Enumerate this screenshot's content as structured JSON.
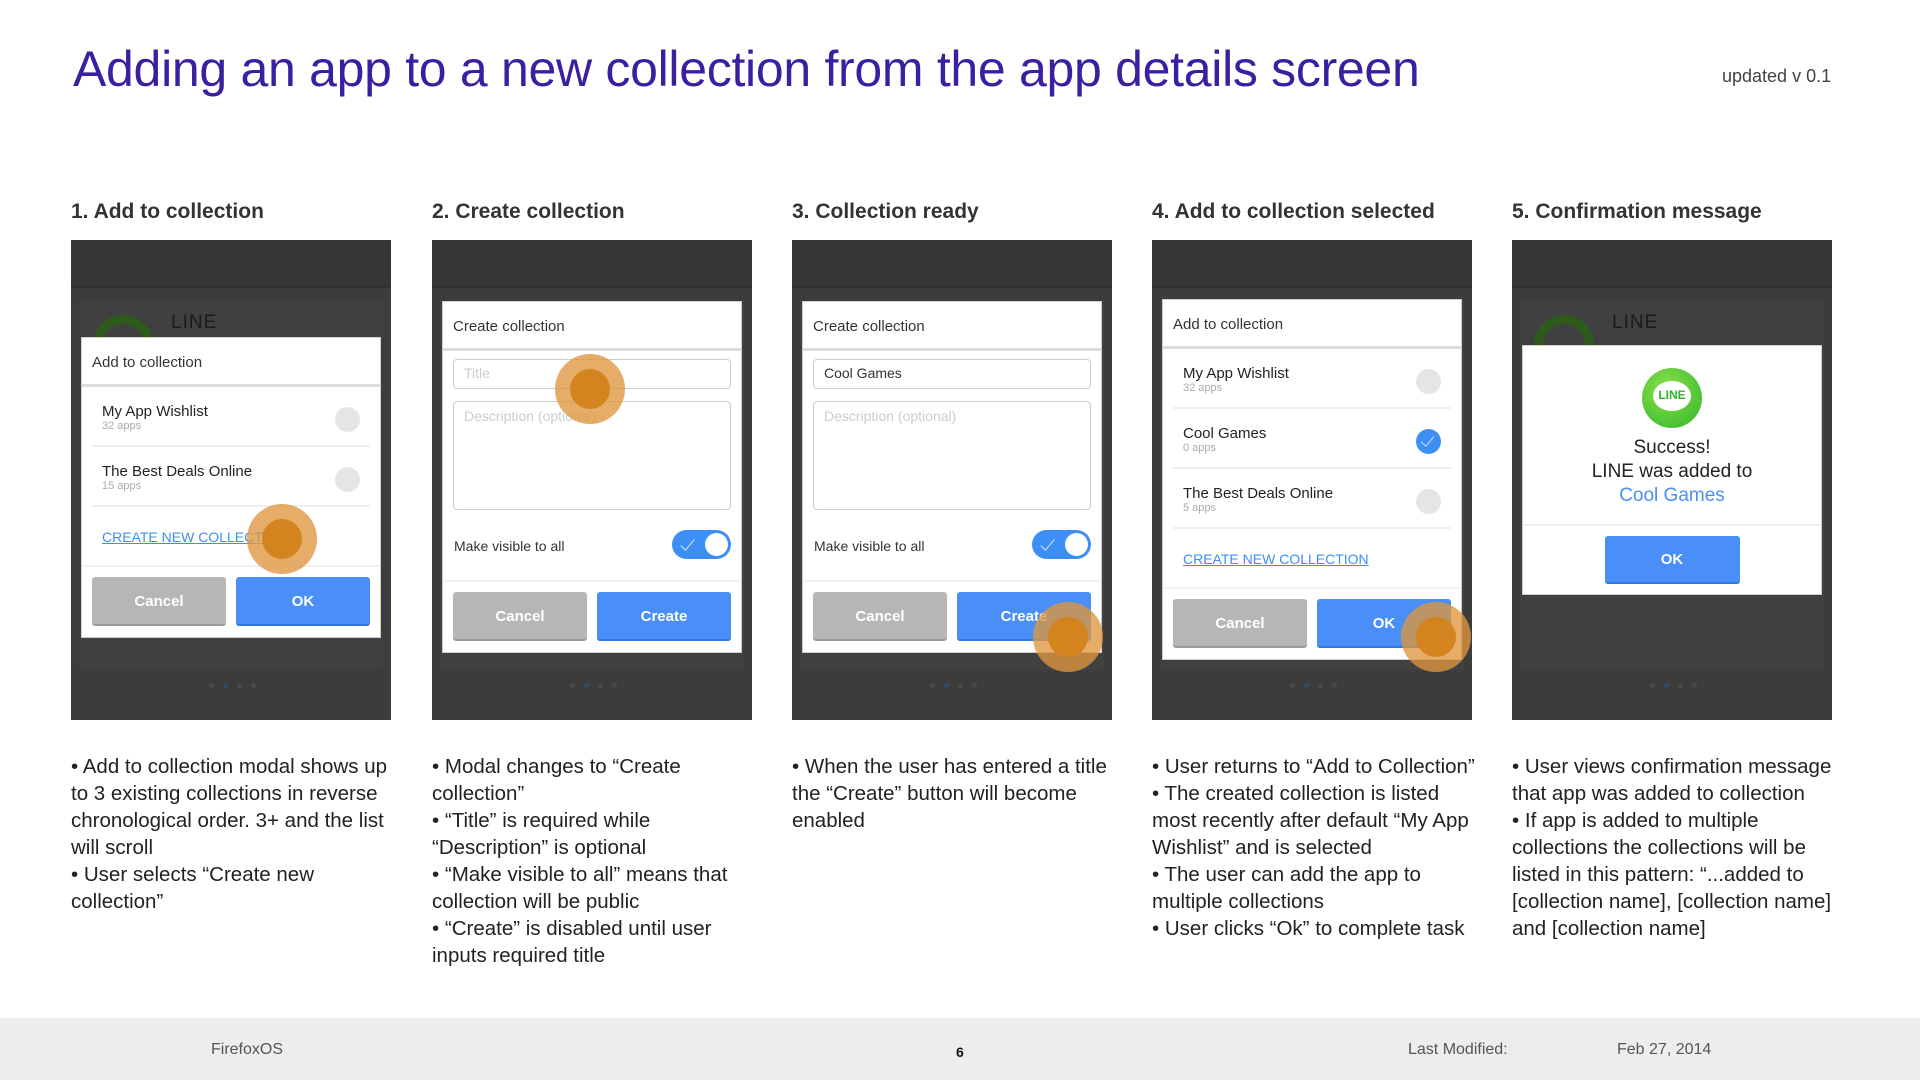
{
  "header": {
    "title": "Adding an app to a new collection from the app details screen",
    "version": "updated v 0.1"
  },
  "colors": {
    "accent": "#4a8ef7",
    "title": "#3a1fa0",
    "touch": "#d3841f"
  },
  "steps": [
    {
      "heading": "1. Add to collection",
      "type": "list",
      "bg_app": "LINE",
      "modal_title": "Add to collection",
      "rows": [
        {
          "name": "My App Wishlist",
          "count": "32 apps",
          "selected": false
        },
        {
          "name": "The Best Deals Online",
          "count": "15 apps",
          "selected": false
        }
      ],
      "link": "CREATE NEW COLLECTION",
      "cancel": "Cancel",
      "ok": "OK",
      "bullets": [
        "• Add to collection modal shows up to 3 existing collections in reverse chronological order. 3+ and the list will scroll",
        "• User selects “Create new collection”"
      ]
    },
    {
      "heading": "2. Create collection",
      "type": "create",
      "modal_title": "Create collection",
      "title_value": "",
      "title_placeholder": "Title",
      "desc_placeholder": "Description (optional)",
      "toggle_label": "Make visible to all",
      "toggle_on": true,
      "cancel": "Cancel",
      "ok": "Create",
      "bullets": [
        "• Modal changes to “Create collection”",
        "• “Title” is required while “Description” is optional",
        "• “Make visible to all” means that collection will be public",
        "• “Create” is disabled until user inputs required title"
      ]
    },
    {
      "heading": "3. Collection ready",
      "type": "create",
      "modal_title": "Create collection",
      "title_value": "Cool Games",
      "title_placeholder": "Title",
      "desc_placeholder": "Description (optional)",
      "toggle_label": "Make visible to all",
      "toggle_on": true,
      "cancel": "Cancel",
      "ok": "Create",
      "bullets": [
        "• When the user has entered a title the “Create” button will become enabled"
      ]
    },
    {
      "heading": "4. Add to collection selected",
      "type": "list",
      "modal_title": "Add to collection",
      "rows": [
        {
          "name": "My App Wishlist",
          "count": "32 apps",
          "selected": false
        },
        {
          "name": "Cool Games",
          "count": "0 apps",
          "selected": true
        },
        {
          "name": "The Best Deals Online",
          "count": "5 apps",
          "selected": false
        }
      ],
      "link": "CREATE NEW COLLECTION",
      "cancel": "Cancel",
      "ok": "OK",
      "bullets": [
        "• User returns to “Add to Collection”",
        "• The created collection is listed most recently after default “My App Wishlist” and is selected",
        "•  The user can add the app to multiple collections",
        "• User clicks “Ok” to complete task"
      ]
    },
    {
      "heading": "5. Confirmation message",
      "type": "success",
      "bg_app": "LINE",
      "icon_text": "LINE",
      "line1": "Success!",
      "line2": "LINE was added to",
      "collection": "Cool Games",
      "ok": "OK",
      "bullets": [
        "• User views confirmation message that app was added to collection",
        "• If app is added to multiple collections the collections will be listed in this pattern:  “...added to [collection name], [collection name] and [collection name]"
      ]
    }
  ],
  "footer": {
    "brand": "FirefoxOS",
    "page": "6",
    "modified_label": "Last Modified:",
    "modified_date": "Feb 27, 2014"
  }
}
